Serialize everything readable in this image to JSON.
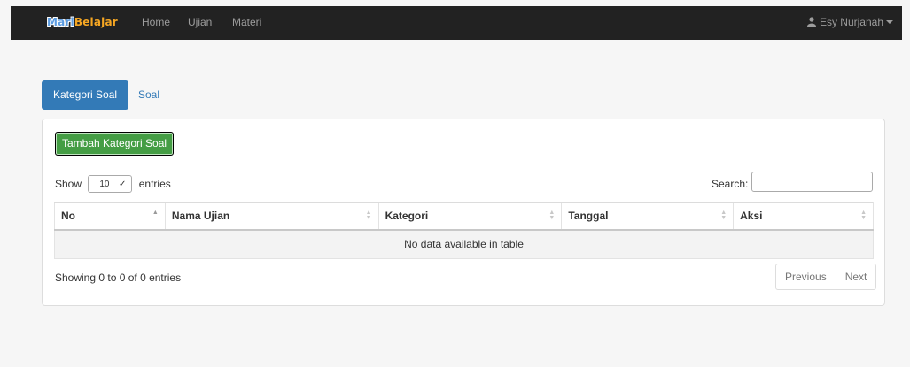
{
  "navbar": {
    "brand_part1": "Mari",
    "brand_part2": "Belajar",
    "links": [
      "Home",
      "Ujian",
      "Materi"
    ],
    "user_name": "Esy Nurjanah"
  },
  "tabs": [
    {
      "label": "Kategori Soal",
      "active": true
    },
    {
      "label": "Soal",
      "active": false
    }
  ],
  "panel": {
    "add_button": "Tambah Kategori Soal",
    "show_label": "Show",
    "entries_value": "10",
    "entries_label": "entries",
    "search_label": "Search:",
    "search_value": "",
    "columns": [
      "No",
      "Nama Ujian",
      "Kategori",
      "Tanggal",
      "Aksi"
    ],
    "empty_message": "No data available in table",
    "info": "Showing 0 to 0 of 0 entries",
    "pagination": {
      "previous": "Previous",
      "next": "Next"
    }
  },
  "colors": {
    "navbar_bg": "#222222",
    "primary": "#337ab7",
    "success": "#449d44"
  }
}
